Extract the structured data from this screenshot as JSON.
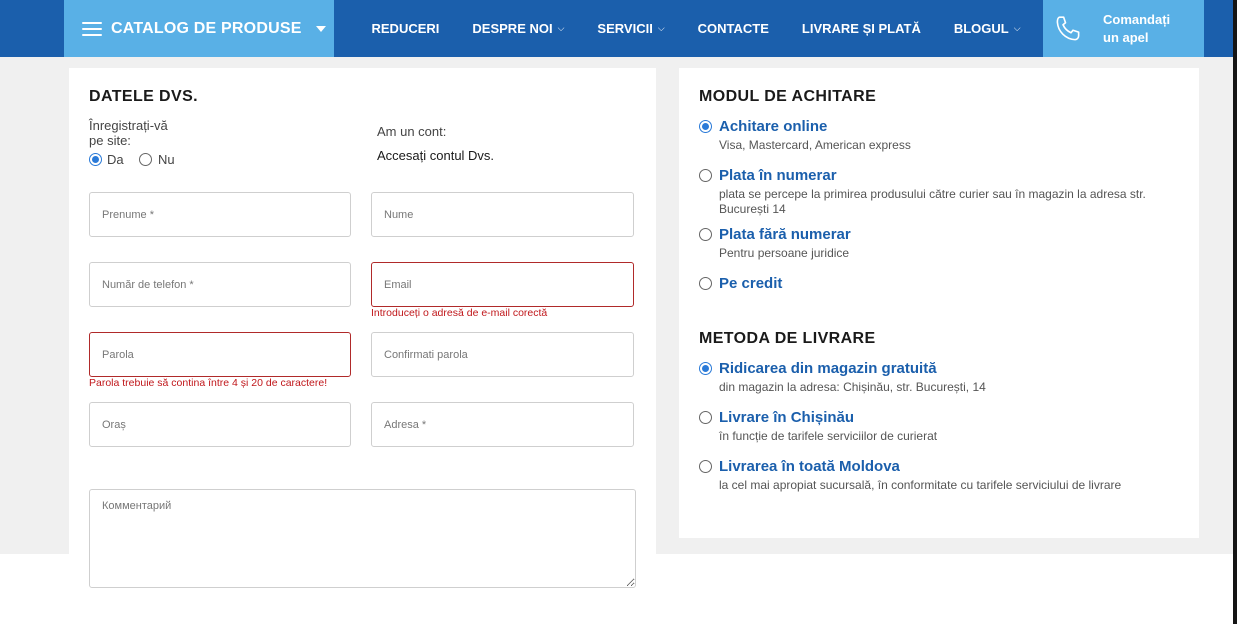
{
  "colors": {
    "nav_bg": "#1b5fac",
    "accent_light": "#59b0e6",
    "link": "#1b5fac",
    "error": "#c0171b",
    "band": "#f0f0f0"
  },
  "header": {
    "catalog_label": "CATALOG DE PRODUSE",
    "nav": [
      {
        "label": "REDUCERI",
        "has_dropdown": false
      },
      {
        "label": "DESPRE NOI",
        "has_dropdown": true
      },
      {
        "label": "SERVICII",
        "has_dropdown": true
      },
      {
        "label": "CONTACTE",
        "has_dropdown": false
      },
      {
        "label": "LIVRARE ȘI PLATĂ",
        "has_dropdown": false
      },
      {
        "label": "BLOGUL",
        "has_dropdown": true
      }
    ],
    "call_line1": "Comandați",
    "call_line2": "un apel",
    "icons": {
      "menu": "hamburger-icon",
      "catalog_caret": "caret-down-icon",
      "chevron": "chevron-down-icon",
      "call": "phone-icon"
    }
  },
  "form": {
    "title": "DATELE DVS.",
    "register_question": "Înregistrați-vă pe site:",
    "register_yes": "Da",
    "register_no": "Nu",
    "register_selected": "Da",
    "have_account": "Am un cont:",
    "login_link": "Accesați contul Dvs.",
    "fields": {
      "first_name": {
        "placeholder": "Prenume *",
        "value": ""
      },
      "last_name": {
        "placeholder": "Nume",
        "value": ""
      },
      "phone": {
        "placeholder": "Număr de telefon *",
        "value": ""
      },
      "email": {
        "placeholder": "Email",
        "value": "",
        "error": "Introduceți o adresă de e-mail corectă"
      },
      "password": {
        "placeholder": "Parola",
        "value": "",
        "error": "Parola trebuie să contina între 4 și 20 de caractere!"
      },
      "confirm_password": {
        "placeholder": "Confirmati parola",
        "value": ""
      },
      "city": {
        "placeholder": "Oraș",
        "value": ""
      },
      "address": {
        "placeholder": "Adresa *",
        "value": ""
      },
      "comment": {
        "placeholder": "Комментарий",
        "value": ""
      }
    }
  },
  "payment": {
    "title": "MODUL DE ACHITARE",
    "options": [
      {
        "label": "Achitare online",
        "desc": "Visa, Mastercard, American express",
        "checked": true
      },
      {
        "label": "Plata în numerar",
        "desc": "plata se percepe la primirea produsului către curier sau în magazin la adresa str. București 14",
        "checked": false
      },
      {
        "label": "Plata fără numerar",
        "desc": "Pentru persoane juridice",
        "checked": false
      },
      {
        "label": "Pe credit",
        "desc": "",
        "checked": false
      }
    ]
  },
  "delivery": {
    "title": "METODA DE LIVRARE",
    "options": [
      {
        "label": "Ridicarea din magazin gratuită",
        "desc": "din magazin la adresa: Chișinău, str. București, 14",
        "checked": true
      },
      {
        "label": "Livrare în Chișinău",
        "desc": "în funcție de tarifele serviciilor de curierat",
        "checked": false
      },
      {
        "label": "Livrarea în toată Moldova",
        "desc": "la cel mai apropiat sucursală, în conformitate cu tarifele serviciului de livrare",
        "checked": false
      }
    ]
  }
}
